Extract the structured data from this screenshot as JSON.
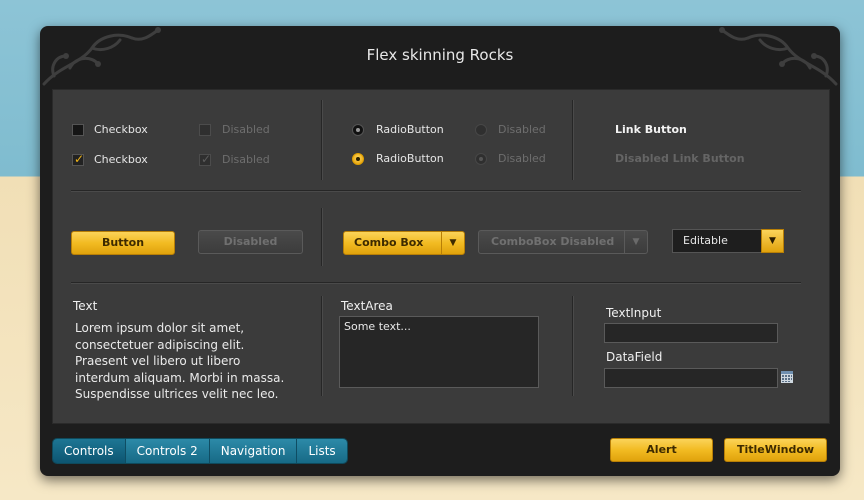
{
  "window": {
    "title": "Flex skinning Rocks"
  },
  "checkboxes": [
    {
      "label": "Checkbox",
      "checked": false,
      "disabled": false
    },
    {
      "label": "Disabled",
      "checked": false,
      "disabled": true
    },
    {
      "label": "Checkbox",
      "checked": true,
      "disabled": false
    },
    {
      "label": "Disabled",
      "checked": true,
      "disabled": true
    }
  ],
  "radios": [
    {
      "label": "RadioButton",
      "selected": false,
      "disabled": false
    },
    {
      "label": "Disabled",
      "selected": false,
      "disabled": true
    },
    {
      "label": "RadioButton",
      "selected": true,
      "disabled": false
    },
    {
      "label": "Disabled",
      "selected": true,
      "disabled": true
    }
  ],
  "links": {
    "link_button": "Link Button",
    "disabled_link_button": "Disabled Link Button"
  },
  "buttons": {
    "button": "Button",
    "disabled": "Disabled",
    "combo_box": "Combo Box",
    "combo_box_disabled": "ComboBox Disabled",
    "editable": "Editable",
    "alert": "Alert",
    "title_window": "TitleWindow"
  },
  "text_section": {
    "label": "Text",
    "body": "Lorem ipsum dolor sit amet,\nconsectetuer adipiscing elit.\nPraesent vel libero ut libero\ninterdum aliquam. Morbi in massa.\nSuspendisse ultrices velit nec leo."
  },
  "textarea": {
    "label": "TextArea",
    "value": "Some text..."
  },
  "text_input": {
    "label": "TextInput",
    "value": ""
  },
  "date_field": {
    "label": "DataField",
    "value": ""
  },
  "tabs": [
    {
      "label": "Controls",
      "active": true
    },
    {
      "label": "Controls 2",
      "active": false
    },
    {
      "label": "Navigation",
      "active": false
    },
    {
      "label": "Lists",
      "active": false
    }
  ],
  "icons": {
    "checkmark": "checkmark-icon",
    "dropdown": "chevron-down-icon",
    "calendar": "calendar-icon",
    "ornament": "swirl-ornament"
  },
  "colors": {
    "accent": "#f2bb22",
    "tab_blue": "#1f7896",
    "panel": "#3b3b3b",
    "window": "#1d1d1d"
  }
}
